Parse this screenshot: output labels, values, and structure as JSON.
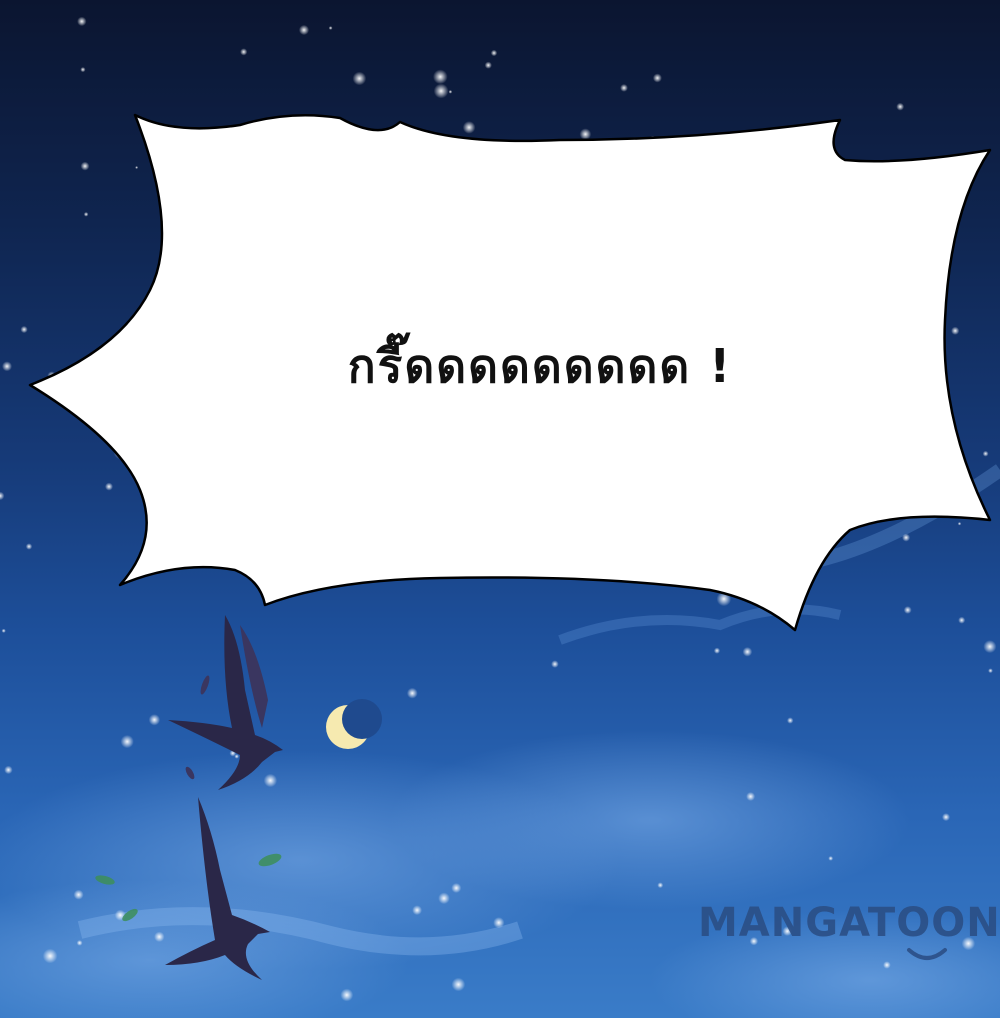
{
  "speech_bubble": {
    "text": "กรี๊ดดดดดดดดด !"
  },
  "watermark": {
    "text": "MANGATOON"
  },
  "colors": {
    "sky_top": "#0b1530",
    "sky_bottom": "#3a7cc8",
    "bubble_fill": "#ffffff",
    "bubble_stroke": "#000000",
    "moon": "#f6eab0",
    "crow": "#2a2748",
    "watermark": "#2b4f86"
  },
  "scene_elements": [
    "night-sky",
    "snowflakes",
    "clouds",
    "crescent-moon",
    "crow",
    "leaves"
  ]
}
